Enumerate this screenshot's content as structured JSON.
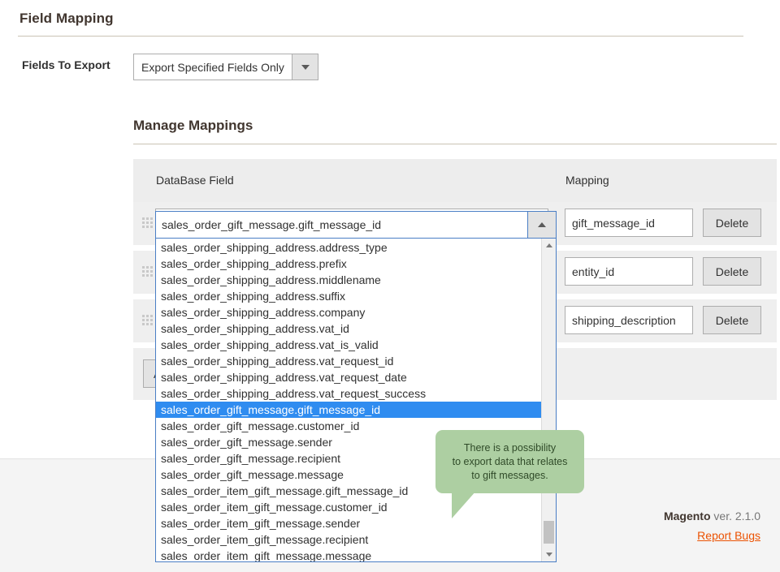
{
  "page": {
    "title": "Field Mapping"
  },
  "fields_to_export": {
    "label": "Fields To Export",
    "value": "Export Specified Fields Only",
    "caret_icon": "chevron-down-icon"
  },
  "manage_mappings": {
    "title": "Manage Mappings",
    "columns": {
      "database_field": "DataBase Field",
      "mapping": "Mapping"
    },
    "add_button_label": "Add New Mapping",
    "rows": [
      {
        "database_field": "sales_order_gift_message.gift_message_id",
        "mapping": "gift_message_id",
        "delete_label": "Delete",
        "drag_icon": "drag-handle-icon"
      },
      {
        "database_field": "",
        "mapping": "entity_id",
        "delete_label": "Delete",
        "drag_icon": "drag-handle-icon"
      },
      {
        "database_field": "",
        "mapping": "shipping_description",
        "delete_label": "Delete",
        "drag_icon": "drag-handle-icon"
      }
    ]
  },
  "combobox": {
    "value": "sales_order_gift_message.gift_message_id",
    "expanded": true,
    "toggle_icon": "chevron-up-icon",
    "scrollbar": {
      "up_icon": "scroll-up-arrow-icon",
      "down_icon": "scroll-down-arrow-icon"
    },
    "selected_option": "sales_order_gift_message.gift_message_id",
    "options": [
      "sales_order_shipping_address.address_type",
      "sales_order_shipping_address.prefix",
      "sales_order_shipping_address.middlename",
      "sales_order_shipping_address.suffix",
      "sales_order_shipping_address.company",
      "sales_order_shipping_address.vat_id",
      "sales_order_shipping_address.vat_is_valid",
      "sales_order_shipping_address.vat_request_id",
      "sales_order_shipping_address.vat_request_date",
      "sales_order_shipping_address.vat_request_success",
      "sales_order_gift_message.gift_message_id",
      "sales_order_gift_message.customer_id",
      "sales_order_gift_message.sender",
      "sales_order_gift_message.recipient",
      "sales_order_gift_message.message",
      "sales_order_item_gift_message.gift_message_id",
      "sales_order_item_gift_message.customer_id",
      "sales_order_item_gift_message.sender",
      "sales_order_item_gift_message.recipient",
      "sales_order_item_gift_message.message"
    ]
  },
  "callout": {
    "text": "There is a possibility\nto export data that relates\nto gift messages.",
    "background": "#adcfa2"
  },
  "footer": {
    "version_brand": "Magento",
    "version_text": " ver. 2.1.0",
    "report_bugs": "Report Bugs",
    "link_color": "#eb5202"
  }
}
